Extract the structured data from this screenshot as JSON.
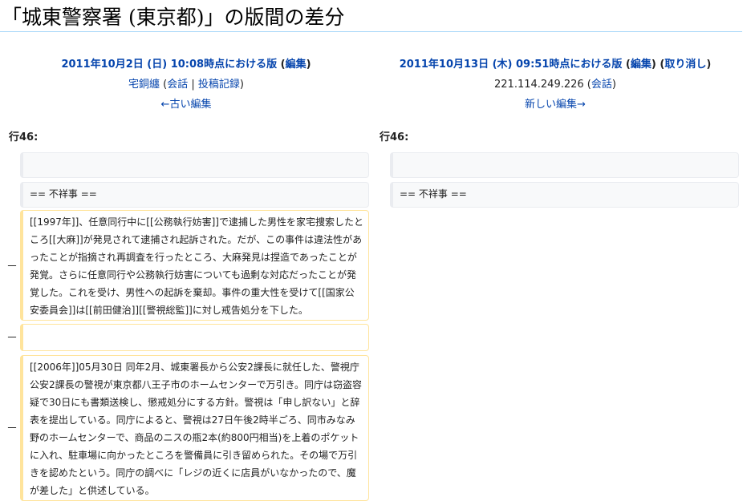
{
  "page": {
    "title": "「城東警察署 (東京都)」の版間の差分"
  },
  "left_revision": {
    "timestamp_link": "2011年10月2日 (日) 10:08時点における版",
    "edit_open": " (",
    "edit_label": "編集",
    "edit_close": ")",
    "user_link": "宅銅纏",
    "talk_open": " (",
    "talk_label": "会話",
    "separator": " | ",
    "contribs_label": "投稿記録",
    "talk_close": ")",
    "older_edit_label": "←古い編集"
  },
  "right_revision": {
    "timestamp_link": "2011年10月13日 (木) 09:51時点における版",
    "edit_open": " (",
    "edit_label": "編集",
    "edit_close": ")",
    "undo_open": " (",
    "undo_label": "取り消し",
    "undo_close": ")",
    "user_ip": "221.114.249.226",
    "talk_open": " (",
    "talk_label": "会話",
    "talk_close": ")",
    "newer_edit_label": "新しい編集→"
  },
  "diff": {
    "left_line_label": "行46:",
    "right_line_label": "行46:",
    "context_empty": "",
    "context_heading": "== 不祥事 ==",
    "deleted_marker": "－",
    "deleted_block_1": "[[1997年]]、任意同行中に[[公務執行妨害]]で逮捕した男性を家宅捜索したところ[[大麻]]が発見されて逮捕され起訴された。だが、この事件は違法性があったことが指摘され再調査を行ったところ、大麻発見は捏造であったことが発覚。さらに任意同行や公務執行妨害についても過剰な対応だったことが発覚した。これを受け、男性への起訴を棄却。事件の重大性を受けて[[国家公安委員会]]は[[前田健治]][[警視総監]]に対し戒告処分を下した。",
    "deleted_block_2": "",
    "deleted_block_3": "[[2006年]]05月30日 同年2月、城東署長から公安2課長に就任した、警視庁公安2課長の警視が東京都八王子市のホームセンターで万引き。同庁は窃盗容疑で30日にも書類送検し、懲戒処分にする方針。警視は「申し訳ない」と辞表を提出している。同庁によると、警視は27日午後2時半ごろ、同市みなみ野のホームセンターで、商品のニスの瓶2本(約800円相当)を上着のポケットに入れ、駐車場に向かったところを警備員に引き留められた。その場で万引きを認めたという。同庁の調べに「レジの近くに店員がいなかったので、魔が差した」と供述している。"
  },
  "colors": {
    "link": "#0645ad",
    "context_bg": "#f8f9fa",
    "context_border": "#eaecf0",
    "deleted_border": "#ffe49c",
    "title_rule": "#a7d7f9"
  }
}
